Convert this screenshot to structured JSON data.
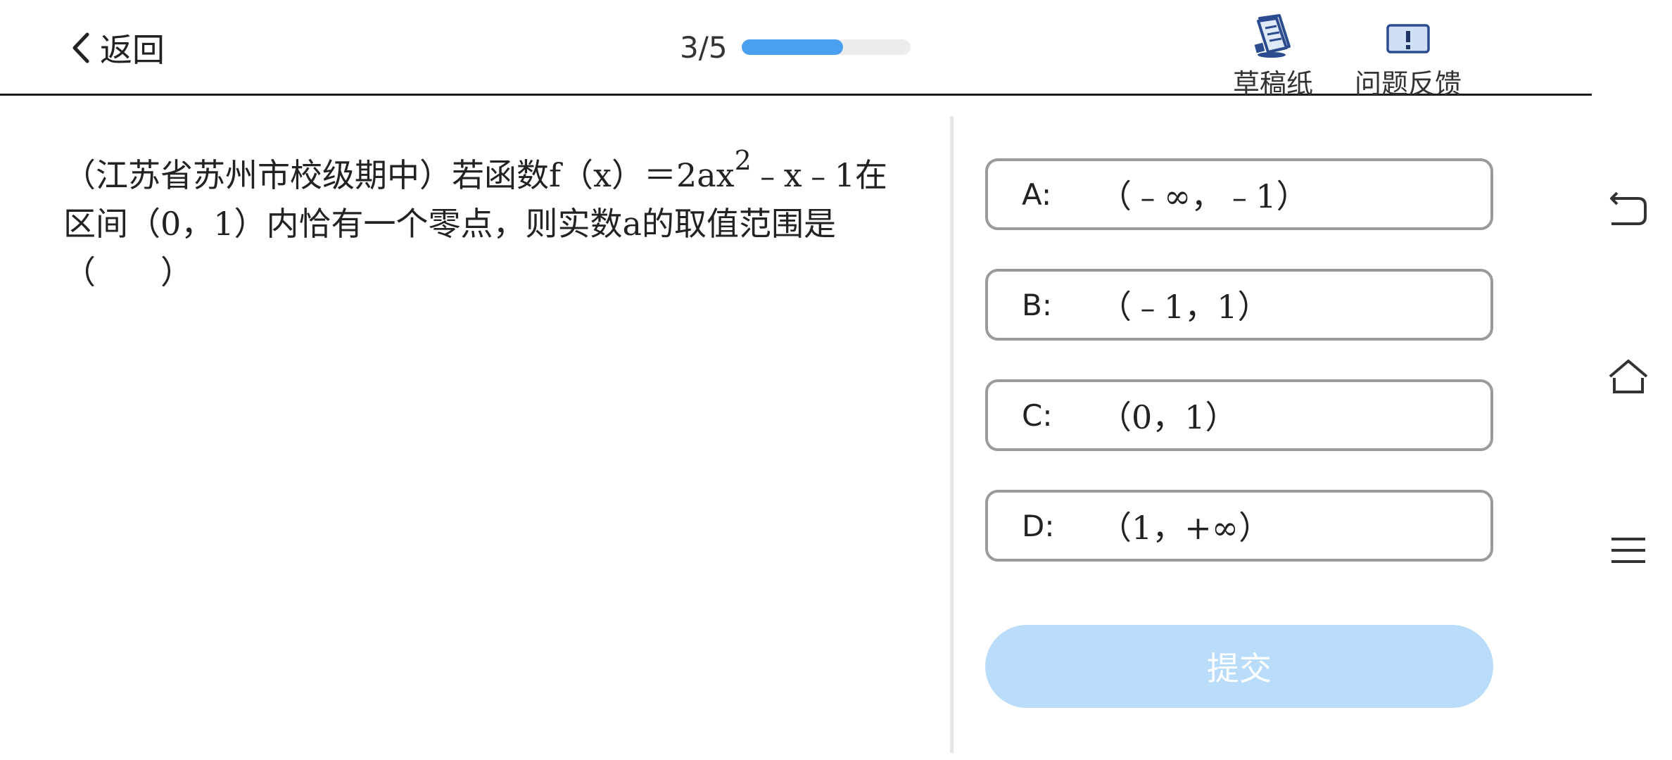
{
  "header": {
    "back_label": "返回",
    "progress_text": "3/5",
    "progress_fraction": 0.6,
    "draft_label": "草稿纸",
    "feedback_label": "问题反馈",
    "accent_color": "#4aa0f0"
  },
  "question": {
    "part1": "（江苏省苏州市校级期中）若函数f（x）＝2ax",
    "superscript": "2",
    "part2": "﹣x﹣1在区间（0，1）内恰有一个零点，则实数a的取值范围是（　　）"
  },
  "options": [
    {
      "letter": "A:",
      "text": "（﹣∞，﹣1）"
    },
    {
      "letter": "B:",
      "text": "（﹣1，1）"
    },
    {
      "letter": "C:",
      "text": "（0，1）"
    },
    {
      "letter": "D:",
      "text": "（1，+∞）"
    }
  ],
  "submit_label": "提交",
  "system_nav": {
    "icons": [
      "back-icon",
      "home-icon",
      "menu-icon"
    ]
  }
}
